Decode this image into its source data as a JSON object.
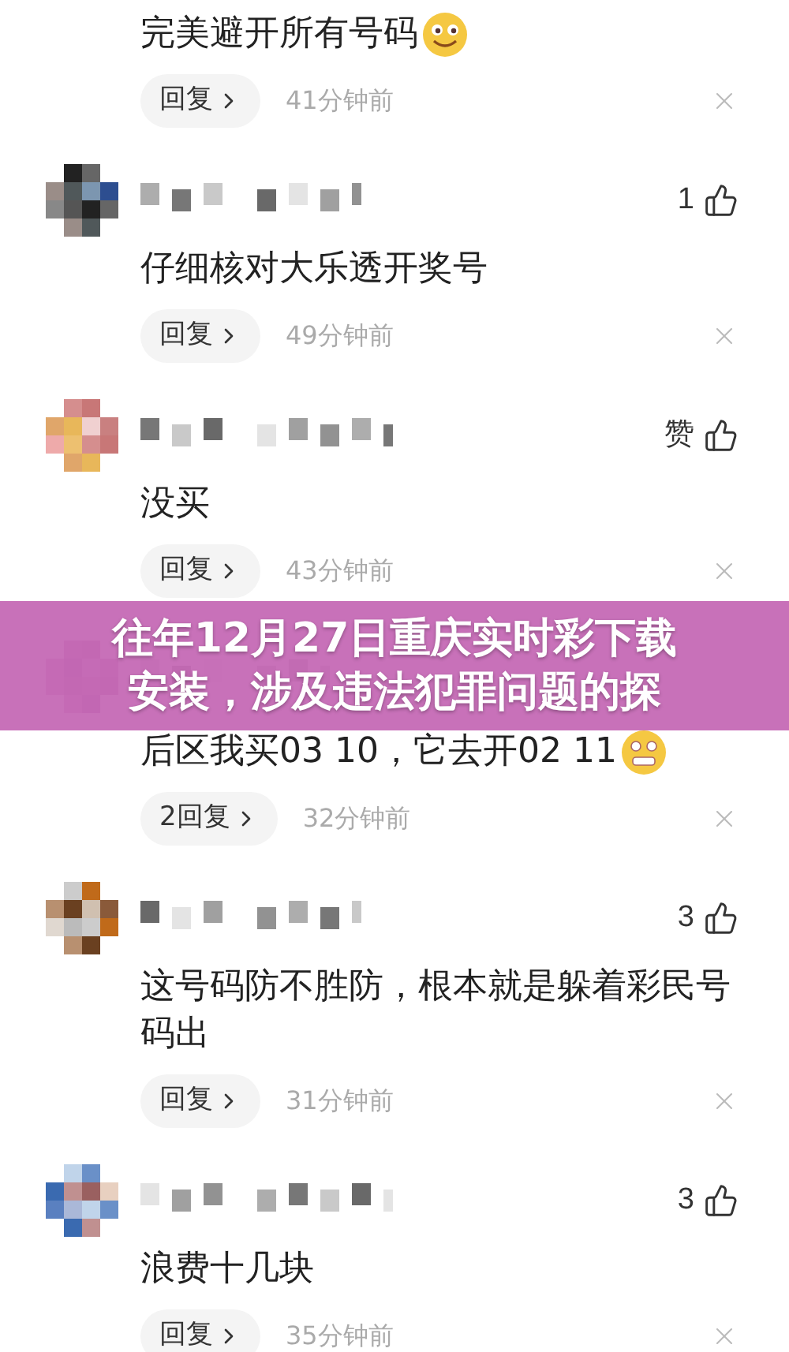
{
  "comments": [
    {
      "header": false,
      "text": "完美避开所有号码",
      "kind": "smile-emoji",
      "reply": "回复",
      "time": "41分钟前"
    },
    {
      "header": true,
      "like": "1",
      "text": "仔细核对大乐透开奖号",
      "reply": "回复",
      "time": "49分钟前"
    },
    {
      "header": true,
      "like": "赞",
      "text": "没买",
      "reply": "回复",
      "time": "43分钟前"
    },
    {
      "header": true,
      "text": "后区我买03 10，它去开02 11",
      "kind": "grimace-emoji",
      "reply": "2回复",
      "time": "32分钟前"
    },
    {
      "header": true,
      "like": "3",
      "text": "这号码防不胜防，根本就是躲着彩民号码出",
      "reply": "回复",
      "time": "31分钟前"
    },
    {
      "header": true,
      "like": "3",
      "text": "浪费十几块",
      "reply": "回复",
      "time": "35分钟前"
    }
  ],
  "banner": {
    "lines": [
      "往年12月27日重庆实时彩下载",
      "安装，涉及违法犯罪问题的探"
    ]
  }
}
